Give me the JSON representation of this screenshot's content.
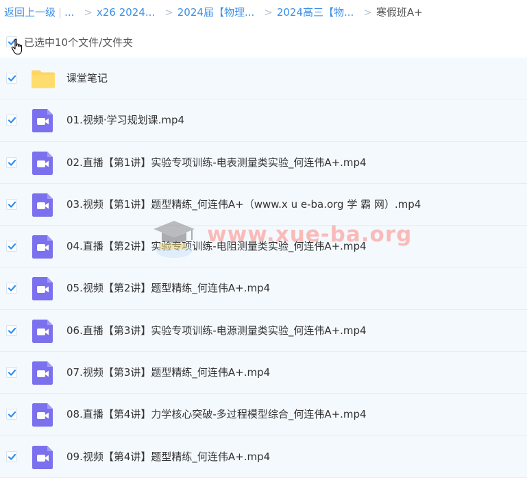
{
  "breadcrumb": {
    "back": "返回上一级",
    "separator": "|",
    "ellipsis": "...",
    "items": [
      "x26 2024...",
      "2024届【物理...",
      "2024高三【物...",
      "寒假班A+"
    ]
  },
  "selection": {
    "label": "已选中10个文件/文件夹",
    "all_checked": true
  },
  "files": [
    {
      "name": "课堂笔记",
      "type": "folder",
      "checked": true
    },
    {
      "name": "01.视频·学习规划课.mp4",
      "type": "video",
      "checked": true
    },
    {
      "name": "02.直播【第1讲】实验专项训练-电表测量类实验_何连伟A+.mp4",
      "type": "video",
      "checked": true
    },
    {
      "name": "03.视频【第1讲】题型精练_何连伟A+（www.x u e-ba.org 学 霸 网）.mp4",
      "type": "video",
      "checked": true
    },
    {
      "name": "04.直播【第2讲】实验专项训练-电阻测量类实验_何连伟A+.mp4",
      "type": "video",
      "checked": true
    },
    {
      "name": "05.视频【第2讲】题型精练_何连伟A+.mp4",
      "type": "video",
      "checked": true
    },
    {
      "name": "06.直播【第3讲】实验专项训练-电源测量类实验_何连伟A+.mp4",
      "type": "video",
      "checked": true
    },
    {
      "name": "07.视频【第3讲】题型精练_何连伟A+.mp4",
      "type": "video",
      "checked": true
    },
    {
      "name": "08.直播【第4讲】力学核心突破-多过程模型综合_何连伟A+.mp4",
      "type": "video",
      "checked": true
    },
    {
      "name": "09.视频【第4讲】题型精练_何连伟A+.mp4",
      "type": "video",
      "checked": true
    }
  ],
  "watermark": {
    "text": "www.xue-ba.org"
  },
  "colors": {
    "link": "#3a8ee6",
    "check": "#2b8ef0",
    "row_bg": "#f4f9fe",
    "video_icon": "#7b70ee",
    "folder_icon": "#ffd560"
  }
}
